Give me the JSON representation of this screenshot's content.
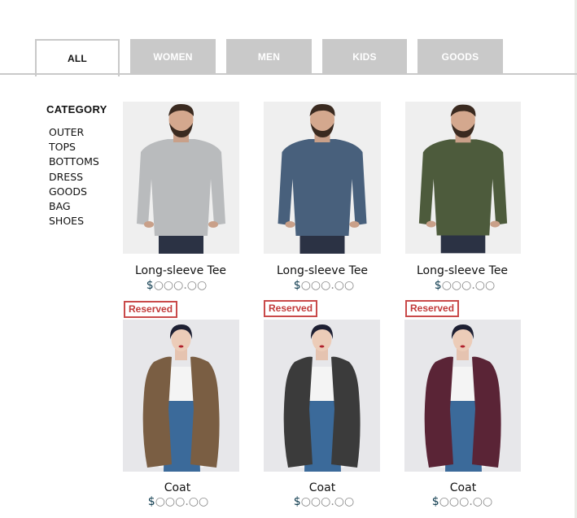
{
  "tabs": [
    {
      "label": "ALL",
      "active": true
    },
    {
      "label": "WOMEN",
      "active": false
    },
    {
      "label": "MEN",
      "active": false
    },
    {
      "label": "KIDS",
      "active": false
    },
    {
      "label": "GOODS",
      "active": false
    }
  ],
  "sidebar": {
    "title": "CATEGORY",
    "items": [
      "OUTER",
      "TOPS",
      "BOTTOMS",
      "DRESS",
      "GOODS",
      "BAG",
      "SHOES"
    ]
  },
  "products": [
    {
      "name": "Long-sleeve Tee",
      "currency": "$",
      "price": "○○○.○○",
      "color": "#b9bbbd",
      "image": "man-gray-sweater",
      "reserved": null
    },
    {
      "name": "Long-sleeve Tee",
      "currency": "$",
      "price": "○○○.○○",
      "color": "#48607c",
      "image": "man-blue-sweater",
      "reserved": null
    },
    {
      "name": "Long-sleeve Tee",
      "currency": "$",
      "price": "○○○.○○",
      "color": "#4d5b3c",
      "image": "man-green-sweater",
      "reserved": null
    },
    {
      "name": "Coat",
      "currency": "$",
      "price": "○○○.○○",
      "color": "#7a5e43",
      "image": "woman-brown-coat",
      "reserved": "Reserved"
    },
    {
      "name": "Coat",
      "currency": "$",
      "price": "○○○.○○",
      "color": "#3b3b3b",
      "image": "woman-tweed-coat",
      "reserved": "Reserved"
    },
    {
      "name": "Coat",
      "currency": "$",
      "price": "○○○.○○",
      "color": "#5a2436",
      "image": "woman-burgundy-coat",
      "reserved": "Reserved"
    }
  ]
}
